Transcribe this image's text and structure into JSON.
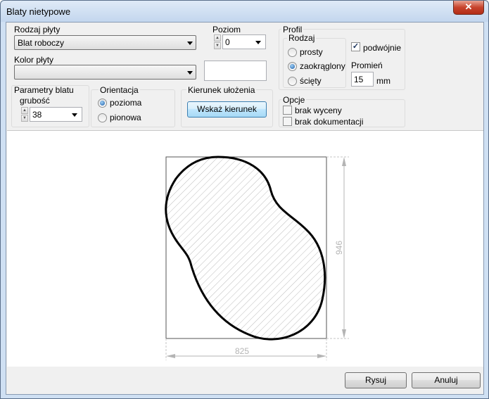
{
  "window": {
    "title": "Blaty nietypowe",
    "close_icon": "close-icon"
  },
  "rodzaj_plyty": {
    "label": "Rodzaj płyty",
    "value": "Blat roboczy"
  },
  "poziom": {
    "label": "Poziom",
    "value": "0"
  },
  "kolor_plyty": {
    "label": "Kolor płyty",
    "value": ""
  },
  "parametry": {
    "label": "Parametry blatu",
    "grubosc_label": "grubość",
    "grubosc_value": "38"
  },
  "orientacja": {
    "label": "Orientacja",
    "options": [
      "pozioma",
      "pionowa"
    ],
    "selected": "pozioma"
  },
  "kierunek": {
    "label": "Kierunek ułożenia",
    "button": "Wskaż kierunek"
  },
  "profil": {
    "label": "Profil",
    "rodzaj_label": "Rodzaj",
    "options": [
      "prosty",
      "zaokrąglony",
      "ścięty"
    ],
    "selected": "zaokrąglony",
    "podwojnie_label": "podwójnie",
    "podwojnie_checked": true,
    "promien_label": "Promień",
    "promien_value": "15",
    "unit": "mm"
  },
  "opcje": {
    "label": "Opcje",
    "items": [
      {
        "label": "brak wyceny",
        "checked": false
      },
      {
        "label": "brak dokumentacji",
        "checked": false
      }
    ]
  },
  "drawing": {
    "width_dim": "825",
    "height_dim": "946"
  },
  "buttons": {
    "rysuj": "Rysuj",
    "anuluj": "Anuluj"
  }
}
